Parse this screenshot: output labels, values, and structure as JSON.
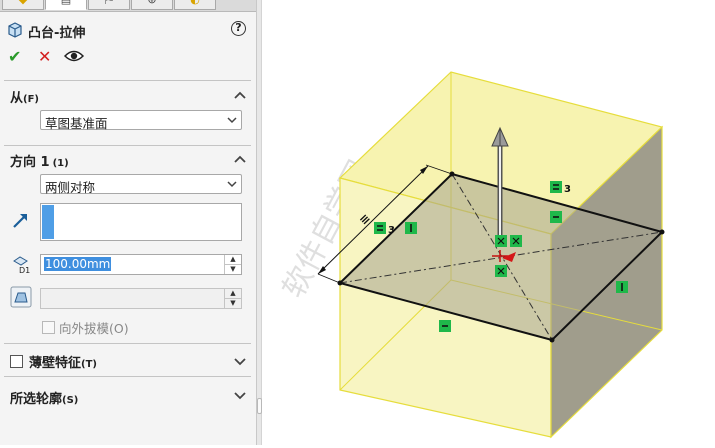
{
  "panel": {
    "tabs": [
      "◆",
      "▤",
      "⛿",
      "⊕",
      "◐"
    ],
    "title": "凸台-拉伸",
    "help": "?",
    "actions": {
      "ok": "✔",
      "cancel": "✕",
      "preview": "👁"
    },
    "from": {
      "title": "从",
      "shortcut": "(F)",
      "value": "草图基准面"
    },
    "direction1": {
      "title": "方向 1",
      "shortcut": "(1)",
      "end_condition": "两侧对称",
      "depth": "100.00mm",
      "draft_label": "向外拔模(O)"
    },
    "thin_feature": {
      "title": "薄壁特征",
      "shortcut": "(T)"
    },
    "selected_contours": {
      "title": "所选轮廓",
      "shortcut": "(S)"
    }
  },
  "viewport": {
    "watermark": "软件自学网",
    "dim_label": "3",
    "relation_label": "3",
    "colors": {
      "extrude_preview": "#f5f1a0",
      "sketch_line": "#111111",
      "relation_badge": "#1fb84a"
    }
  }
}
